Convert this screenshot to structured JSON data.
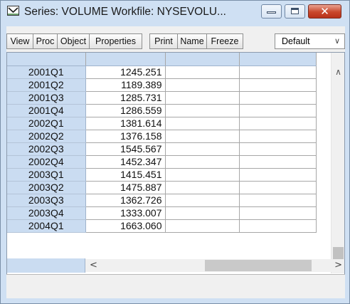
{
  "window": {
    "title": "Series: VOLUME   Workfile: NYSEVOLU...",
    "close_glyph": "✕"
  },
  "toolbar": {
    "buttons": [
      "View",
      "Proc",
      "Object",
      "Properties",
      "Print",
      "Name",
      "Freeze"
    ],
    "select_value": "Default",
    "select_chevron": "∨"
  },
  "table": {
    "rows": [
      {
        "label": "2001Q1",
        "value": "1245.251"
      },
      {
        "label": "2001Q2",
        "value": "1189.389"
      },
      {
        "label": "2001Q3",
        "value": "1285.731"
      },
      {
        "label": "2001Q4",
        "value": "1286.559"
      },
      {
        "label": "2002Q1",
        "value": "1381.614"
      },
      {
        "label": "2002Q2",
        "value": "1376.158"
      },
      {
        "label": "2002Q3",
        "value": "1545.567"
      },
      {
        "label": "2002Q4",
        "value": "1452.347"
      },
      {
        "label": "2003Q1",
        "value": "1415.451"
      },
      {
        "label": "2003Q2",
        "value": "1475.887"
      },
      {
        "label": "2003Q3",
        "value": "1362.726"
      },
      {
        "label": "2003Q4",
        "value": "1333.007"
      },
      {
        "label": "2004Q1",
        "value": "1663.060"
      }
    ]
  },
  "scrollbars": {
    "up": "∧",
    "down": "∨",
    "left": "<",
    "right": ">"
  },
  "colors": {
    "header_blue": "#cadcf1",
    "close_red": "#c9472b",
    "chrome": "#cfe0f3"
  }
}
